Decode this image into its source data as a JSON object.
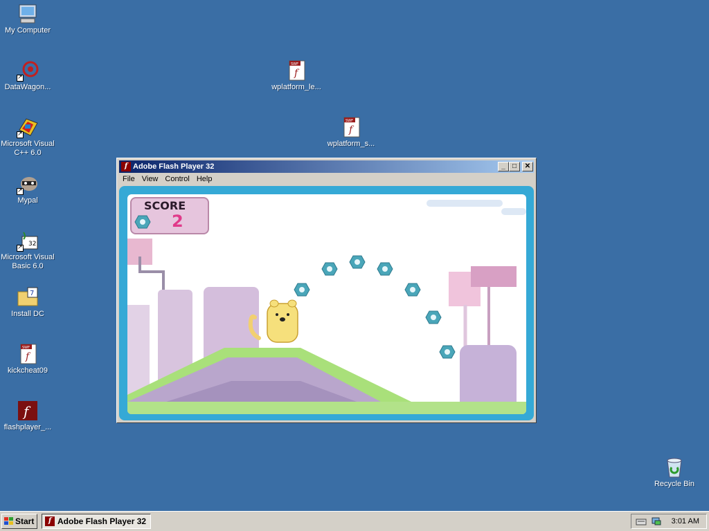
{
  "desktop": {
    "icons": [
      {
        "label": "My Computer",
        "icon": "my-computer-icon"
      },
      {
        "label": "DataWagon...",
        "icon": "datawagon-icon"
      },
      {
        "label": "Microsoft Visual C++ 6.0",
        "icon": "visual-cpp-icon"
      },
      {
        "label": "Mypal",
        "icon": "mypal-icon"
      },
      {
        "label": "Microsoft Visual Basic 6.0",
        "icon": "visual-basic-icon"
      },
      {
        "label": "Install DC",
        "icon": "install-dc-icon"
      },
      {
        "label": "kickcheat09",
        "icon": "swf-file-icon"
      },
      {
        "label": "flashplayer_...",
        "icon": "flashplayer-icon"
      },
      {
        "label": "wplatform_le...",
        "icon": "swf-file-icon"
      },
      {
        "label": "wplatform_s...",
        "icon": "swf-file-icon"
      },
      {
        "label": "Recycle Bin",
        "icon": "recycle-bin-icon"
      }
    ]
  },
  "window": {
    "title": "Adobe Flash Player 32",
    "menu": [
      "File",
      "View",
      "Control",
      "Help"
    ],
    "buttons": {
      "minimize": "_",
      "maximize": "□",
      "close": "✕"
    }
  },
  "game": {
    "score_label": "SCORE",
    "score_value": "2"
  },
  "taskbar": {
    "start_label": "Start",
    "task_label": "Adobe Flash Player 32",
    "clock": "3:01 AM"
  },
  "colors": {
    "desktop": "#3a6ea5",
    "titlebar": "#0a246a",
    "game_frame": "#35a9d6",
    "grass": "#a9e07a",
    "coin": "#4aa6b9"
  }
}
